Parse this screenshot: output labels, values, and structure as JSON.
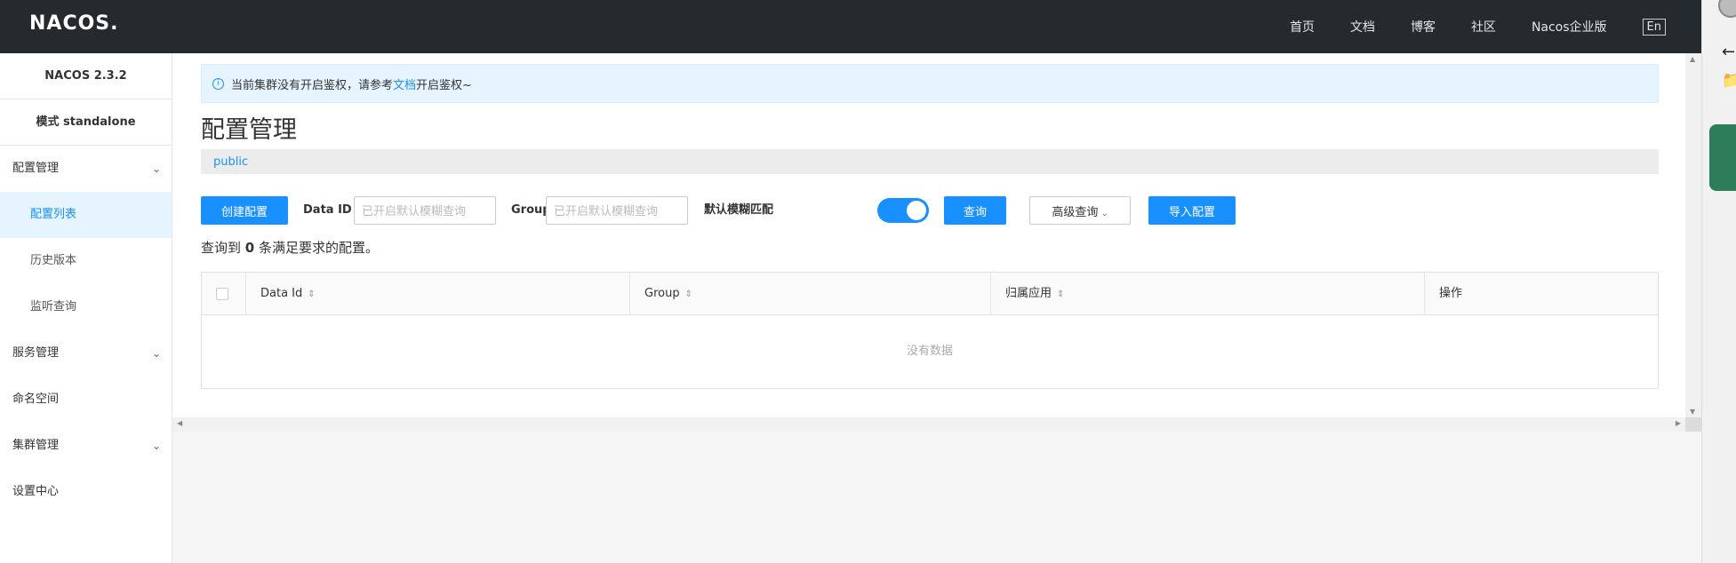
{
  "topbar": {
    "logo": "NACOS.",
    "nav": [
      "首页",
      "文档",
      "博客",
      "社区",
      "Nacos企业版"
    ],
    "lang": "En"
  },
  "sidebar": {
    "title": "NACOS 2.3.2",
    "mode": "模式 standalone",
    "items": [
      {
        "label": "配置管理",
        "expandable": true
      },
      {
        "label": "配置列表",
        "sub": true,
        "active": true
      },
      {
        "label": "历史版本",
        "sub": true
      },
      {
        "label": "监听查询",
        "sub": true
      },
      {
        "label": "服务管理",
        "expandable": true
      },
      {
        "label": "命名空间"
      },
      {
        "label": "集群管理",
        "expandable": true
      },
      {
        "label": "设置中心"
      }
    ]
  },
  "notice": {
    "text_before": "当前集群没有开启鉴权，请参考",
    "link": "文档",
    "text_after": "开启鉴权~"
  },
  "page": {
    "title": "配置管理",
    "namespace": "public"
  },
  "toolbar": {
    "create_label": "创建配置",
    "dataid_label": "Data ID",
    "dataid_placeholder": "已开启默认模糊查询",
    "group_label": "Group",
    "group_placeholder": "已开启默认模糊查询",
    "fuzzy_label": "默认模糊匹配",
    "fuzzy_on": true,
    "query_label": "查询",
    "advanced_label": "高级查询",
    "import_label": "导入配置"
  },
  "result": {
    "prefix": "查询到",
    "count": "0",
    "suffix": "条满足要求的配置。"
  },
  "table": {
    "columns": [
      "Data Id",
      "Group",
      "归属应用",
      "操作"
    ],
    "empty_text": "没有数据"
  }
}
